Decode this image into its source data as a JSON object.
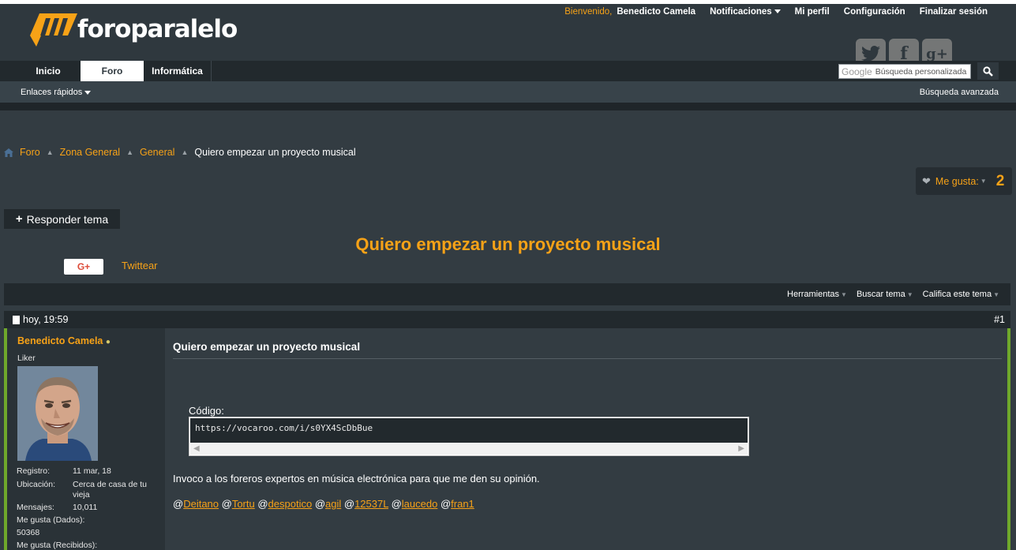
{
  "header": {
    "logo_text": "foroparalelo",
    "welcome": "Bienvenido,",
    "username": "Benedicto Camela",
    "notifications": "Notificaciones",
    "profile": "Mi perfil",
    "settings": "Configuración",
    "logout": "Finalizar sesión",
    "social": [
      "twitter-icon",
      "facebook-icon",
      "google-plus-icon"
    ]
  },
  "nav": {
    "tabs": [
      {
        "label": "Inicio",
        "active": false
      },
      {
        "label": "Foro",
        "active": true
      },
      {
        "label": "Informática",
        "active": false
      }
    ],
    "search_brand": "Google",
    "search_placeholder": "Búsqueda personalizada",
    "quick_links": "Enlaces rápidos",
    "advanced_search": "Búsqueda avanzada"
  },
  "breadcrumb": [
    "Foro",
    "Zona General",
    "General",
    "Quiero empezar un proyecto musical"
  ],
  "likes": {
    "label": "Me gusta:",
    "count": "2"
  },
  "reply_button": "Responder tema",
  "thread_title": "Quiero empezar un proyecto musical",
  "share": {
    "gplus": "G+",
    "tweet": "Twittear"
  },
  "tools": [
    "Herramientas",
    "Buscar tema",
    "Califica este tema"
  ],
  "post": {
    "date": "hoy, 19:59",
    "number": "#1",
    "author": {
      "name": "Benedicto Camela",
      "title": "Liker",
      "stats": [
        {
          "label": "Registro:",
          "value": "11 mar, 18"
        },
        {
          "label": "Ubicación:",
          "value": "Cerca de casa de tu vieja"
        },
        {
          "label": "Mensajes:",
          "value": "10,011"
        },
        {
          "label": "Me gusta (Dados):",
          "value": ""
        },
        {
          "label": "50368",
          "value": ""
        },
        {
          "label": "Me gusta (Recibidos):",
          "value": ""
        }
      ]
    },
    "title": "Quiero empezar un proyecto musical",
    "code_label": "Código:",
    "code": "https://vocaroo.com/i/s0YX4ScDbBue",
    "message": "Invoco a los foreros expertos en música electrónica para que me den su opinión.",
    "mentions": [
      "Deitano",
      "Tortu",
      "despotico",
      "agil",
      "12537L",
      "laucedo",
      "fran1"
    ]
  },
  "colors": {
    "accent": "#f7a217",
    "background": "#333c42",
    "user_border": "#6fa82b"
  }
}
